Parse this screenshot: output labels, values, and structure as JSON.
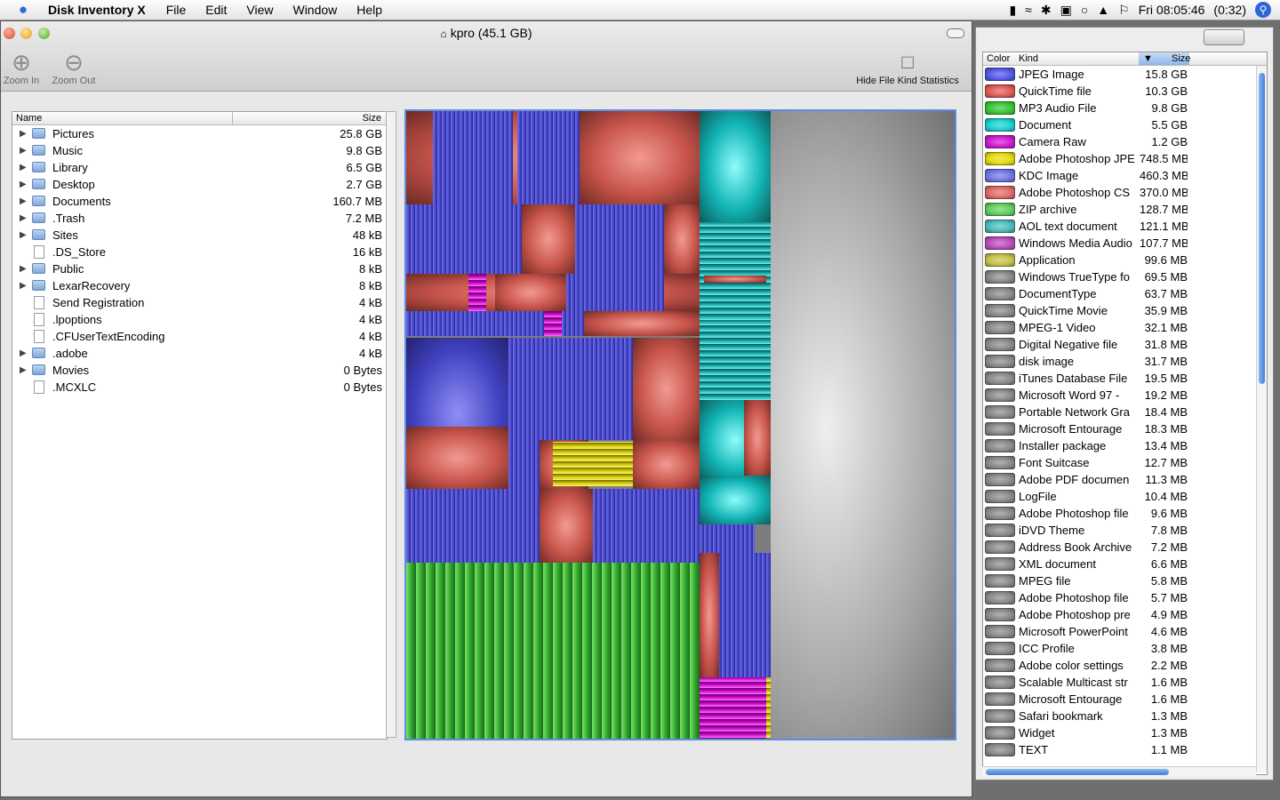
{
  "menubar": {
    "app_name": "Disk Inventory X",
    "menus": [
      "File",
      "Edit",
      "View",
      "Window",
      "Help"
    ],
    "clock": "Fri 08:05:46",
    "battery": "(0:32)"
  },
  "window": {
    "title": "kpro (45.1 GB)"
  },
  "toolbar": {
    "zoom_in": "Zoom In",
    "zoom_out": "Zoom Out",
    "hide_stats": "Hide File Kind Statistics"
  },
  "outline": {
    "col_name": "Name",
    "col_size": "Size",
    "rows": [
      {
        "name": "Pictures",
        "size": "25.8 GB",
        "expandable": true
      },
      {
        "name": "Music",
        "size": "9.8 GB",
        "expandable": true
      },
      {
        "name": "Library",
        "size": "6.5 GB",
        "expandable": true
      },
      {
        "name": "Desktop",
        "size": "2.7 GB",
        "expandable": true
      },
      {
        "name": "Documents",
        "size": "160.7 MB",
        "expandable": true
      },
      {
        "name": ".Trash",
        "size": "7.2 MB",
        "expandable": true
      },
      {
        "name": "Sites",
        "size": "48 kB",
        "expandable": true
      },
      {
        "name": ".DS_Store",
        "size": "16 kB",
        "expandable": false
      },
      {
        "name": "Public",
        "size": "8 kB",
        "expandable": true
      },
      {
        "name": "LexarRecovery",
        "size": "8 kB",
        "expandable": true
      },
      {
        "name": "Send Registration",
        "size": "4 kB",
        "expandable": false
      },
      {
        "name": ".lpoptions",
        "size": "4 kB",
        "expandable": false
      },
      {
        "name": ".CFUserTextEncoding",
        "size": "4 kB",
        "expandable": false
      },
      {
        "name": ".adobe",
        "size": "4 kB",
        "expandable": true
      },
      {
        "name": "Movies",
        "size": "0 Bytes",
        "expandable": true
      },
      {
        "name": ".MCXLC",
        "size": "0 Bytes",
        "expandable": false
      }
    ]
  },
  "kinds": {
    "col_color": "Color",
    "col_kind": "Kind",
    "col_size": "Size",
    "rows": [
      {
        "kind": "JPEG Image",
        "size": "15.8 GB",
        "color": "#5a5aea"
      },
      {
        "kind": "QuickTime file",
        "size": "10.3 GB",
        "color": "#e0605a"
      },
      {
        "kind": "MP3 Audio File",
        "size": "9.8 GB",
        "color": "#3cc83c"
      },
      {
        "kind": "Document",
        "size": "5.5 GB",
        "color": "#1ed2d2"
      },
      {
        "kind": "Camera Raw",
        "size": "1.2 GB",
        "color": "#d21ed2"
      },
      {
        "kind": "Adobe Photoshop JPE",
        "size": "748.5 MB",
        "color": "#e6dc14"
      },
      {
        "kind": "KDC Image",
        "size": "460.3 MB",
        "color": "#7878e6"
      },
      {
        "kind": "Adobe Photoshop CS",
        "size": "370.0 MB",
        "color": "#e0706a"
      },
      {
        "kind": "ZIP archive",
        "size": "128.7 MB",
        "color": "#64d264"
      },
      {
        "kind": "AOL text document",
        "size": "121.1 MB",
        "color": "#50bebe"
      },
      {
        "kind": "Windows Media Audio",
        "size": "107.7 MB",
        "color": "#be50be"
      },
      {
        "kind": "Application",
        "size": "99.6 MB",
        "color": "#c8c350"
      },
      {
        "kind": "Windows TrueType fo",
        "size": "69.5 MB",
        "color": "#8c8c8c"
      },
      {
        "kind": "DocumentType",
        "size": "63.7 MB",
        "color": "#8c8c8c"
      },
      {
        "kind": "QuickTime Movie",
        "size": "35.9 MB",
        "color": "#8c8c8c"
      },
      {
        "kind": "MPEG-1 Video",
        "size": "32.1 MB",
        "color": "#8c8c8c"
      },
      {
        "kind": "Digital Negative file",
        "size": "31.8 MB",
        "color": "#8c8c8c"
      },
      {
        "kind": "disk image",
        "size": "31.7 MB",
        "color": "#8c8c8c"
      },
      {
        "kind": "iTunes Database File",
        "size": "19.5 MB",
        "color": "#8c8c8c"
      },
      {
        "kind": "Microsoft Word 97 -",
        "size": "19.2 MB",
        "color": "#8c8c8c"
      },
      {
        "kind": "Portable Network Gra",
        "size": "18.4 MB",
        "color": "#8c8c8c"
      },
      {
        "kind": "Microsoft Entourage",
        "size": "18.3 MB",
        "color": "#8c8c8c"
      },
      {
        "kind": "Installer package",
        "size": "13.4 MB",
        "color": "#8c8c8c"
      },
      {
        "kind": "Font Suitcase",
        "size": "12.7 MB",
        "color": "#8c8c8c"
      },
      {
        "kind": "Adobe PDF documen",
        "size": "11.3 MB",
        "color": "#8c8c8c"
      },
      {
        "kind": "LogFile",
        "size": "10.4 MB",
        "color": "#8c8c8c"
      },
      {
        "kind": "Adobe Photoshop file",
        "size": "9.6 MB",
        "color": "#8c8c8c"
      },
      {
        "kind": "iDVD Theme",
        "size": "7.8 MB",
        "color": "#8c8c8c"
      },
      {
        "kind": "Address Book Archive",
        "size": "7.2 MB",
        "color": "#8c8c8c"
      },
      {
        "kind": "XML document",
        "size": "6.6 MB",
        "color": "#8c8c8c"
      },
      {
        "kind": "MPEG file",
        "size": "5.8 MB",
        "color": "#8c8c8c"
      },
      {
        "kind": "Adobe Photoshop file",
        "size": "5.7 MB",
        "color": "#8c8c8c"
      },
      {
        "kind": "Adobe Photoshop pre",
        "size": "4.9 MB",
        "color": "#8c8c8c"
      },
      {
        "kind": "Microsoft PowerPoint",
        "size": "4.6 MB",
        "color": "#8c8c8c"
      },
      {
        "kind": "ICC Profile",
        "size": "3.8 MB",
        "color": "#8c8c8c"
      },
      {
        "kind": "Adobe color settings",
        "size": "2.2 MB",
        "color": "#8c8c8c"
      },
      {
        "kind": "Scalable Multicast str",
        "size": "1.6 MB",
        "color": "#8c8c8c"
      },
      {
        "kind": "Microsoft Entourage",
        "size": "1.6 MB",
        "color": "#8c8c8c"
      },
      {
        "kind": "Safari bookmark",
        "size": "1.3 MB",
        "color": "#8c8c8c"
      },
      {
        "kind": "Widget",
        "size": "1.3 MB",
        "color": "#8c8c8c"
      },
      {
        "kind": "TEXT",
        "size": "1.1 MB",
        "color": "#8c8c8c"
      }
    ]
  }
}
